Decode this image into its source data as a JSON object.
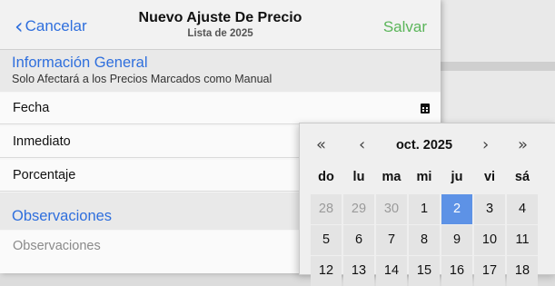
{
  "header": {
    "back_label": "Cancelar",
    "title": "Nuevo Ajuste De Precio",
    "subtitle": "Lista de 2025",
    "save_label": "Salvar"
  },
  "general": {
    "title": "Información General",
    "subtitle": "Solo Afectará a los Precios Marcados como Manual"
  },
  "rows": {
    "fecha": "Fecha",
    "inmediato": "Inmediato",
    "porcentaje": "Porcentaje"
  },
  "observaciones": {
    "title": "Observaciones",
    "placeholder": "Observaciones"
  },
  "calendar": {
    "month": "oct. 2025",
    "weekdays": [
      "do",
      "lu",
      "ma",
      "mi",
      "ju",
      "vi",
      "sá"
    ],
    "weeks": [
      [
        "28",
        "29",
        "30",
        "1",
        "2",
        "3",
        "4"
      ],
      [
        "5",
        "6",
        "7",
        "8",
        "9",
        "10",
        "11"
      ],
      [
        "12",
        "13",
        "14",
        "15",
        "16",
        "17",
        "18"
      ]
    ],
    "selected_day": "2",
    "nav": {
      "prev_year": "«",
      "prev_month": "‹",
      "next_month": "›",
      "next_year": "»"
    }
  }
}
